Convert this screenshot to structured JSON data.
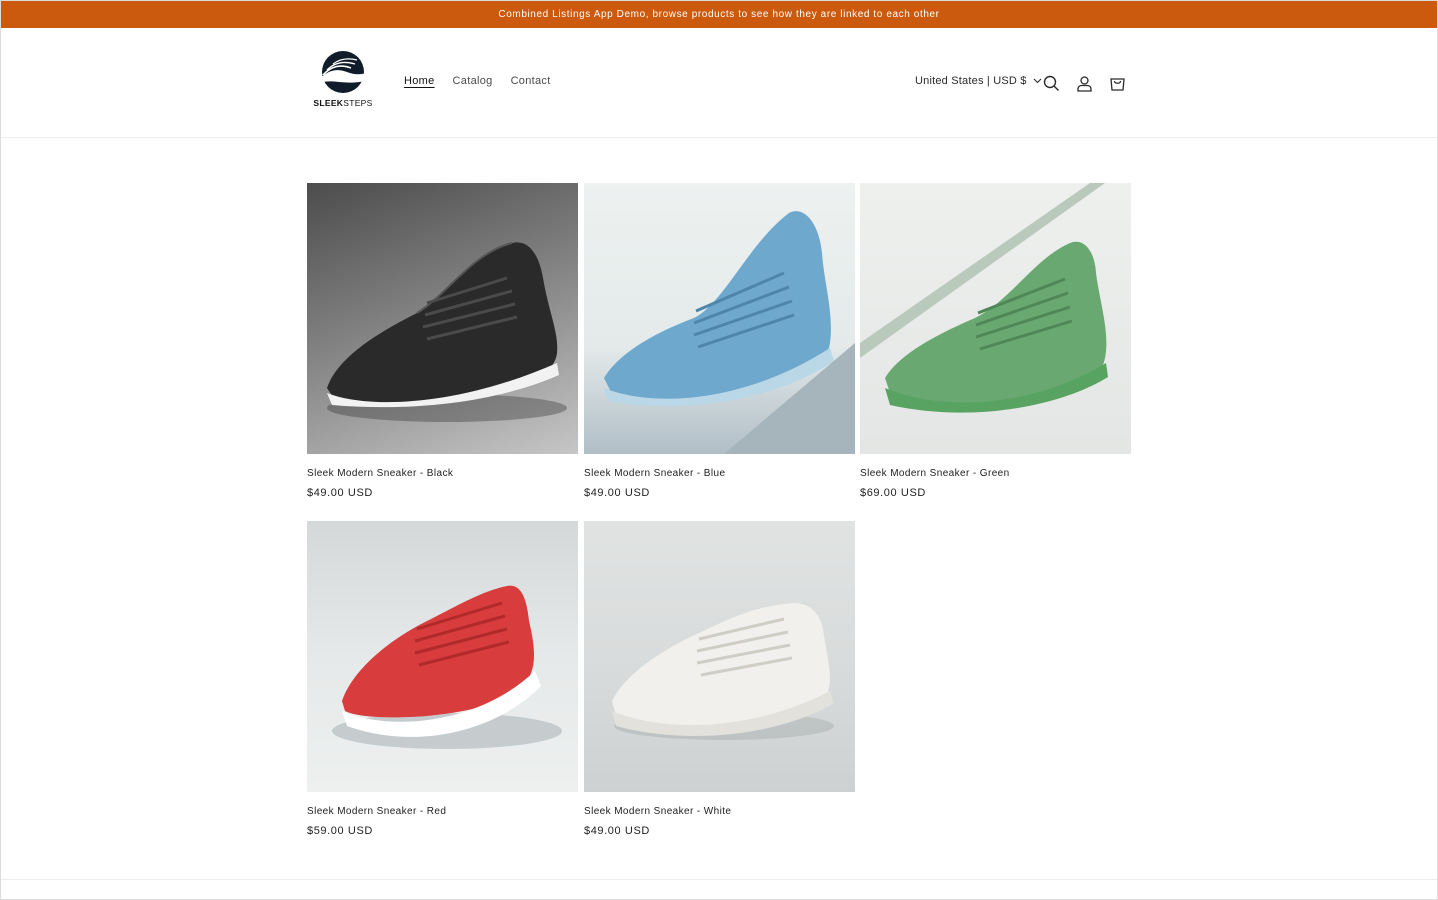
{
  "announcement": "Combined Listings App Demo, browse products to see how they are linked to each other",
  "logo": {
    "bold": "SLEEK",
    "thin": "STEPS"
  },
  "nav": {
    "home": "Home",
    "catalog": "Catalog",
    "contact": "Contact"
  },
  "header": {
    "country": "United States | USD $"
  },
  "icons": [
    "search-icon",
    "account-icon",
    "cart-icon",
    "chevron-down-icon"
  ],
  "colors": {
    "announcement_bg": "#cc5a0e",
    "text": "#121212"
  },
  "products": [
    {
      "title": "Sleek Modern Sneaker - Black",
      "price": "$49.00 USD",
      "color": "#2e2e2e",
      "bg_top": "#5a5a5a",
      "bg_bottom": "#bdbdbd"
    },
    {
      "title": "Sleek Modern Sneaker - Blue",
      "price": "$49.00 USD",
      "color": "#6ea8cc",
      "bg_top": "#e8eeee",
      "bg_bottom": "#aebcc4"
    },
    {
      "title": "Sleek Modern Sneaker - Green",
      "price": "$69.00 USD",
      "color": "#6aa872",
      "bg_top": "#e9ecea",
      "bg_bottom": "#dfe3e0"
    },
    {
      "title": "Sleek Modern Sneaker - Red",
      "price": "$59.00 USD",
      "color": "#d83c3c",
      "bg_top": "#cfd3d3",
      "bg_bottom": "#eceeee"
    },
    {
      "title": "Sleek Modern Sneaker - White",
      "price": "$49.00 USD",
      "color": "#eeeeea",
      "bg_top": "#dfe1e1",
      "bg_bottom": "#cfd3d3"
    }
  ]
}
